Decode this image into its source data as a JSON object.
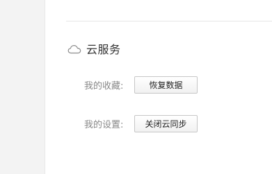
{
  "cloud_service": {
    "title": "云服务",
    "icon": "cloud-icon",
    "rows": [
      {
        "label": "我的收藏:",
        "button_label": "恢复数据"
      },
      {
        "label": "我的设置:",
        "button_label": "关闭云同步"
      }
    ]
  },
  "colors": {
    "left_panel": "#f3f3f3",
    "divider": "#e6e6e6",
    "title_text": "#333333",
    "label_text": "#888888",
    "button_border": "#c6c6c6"
  }
}
